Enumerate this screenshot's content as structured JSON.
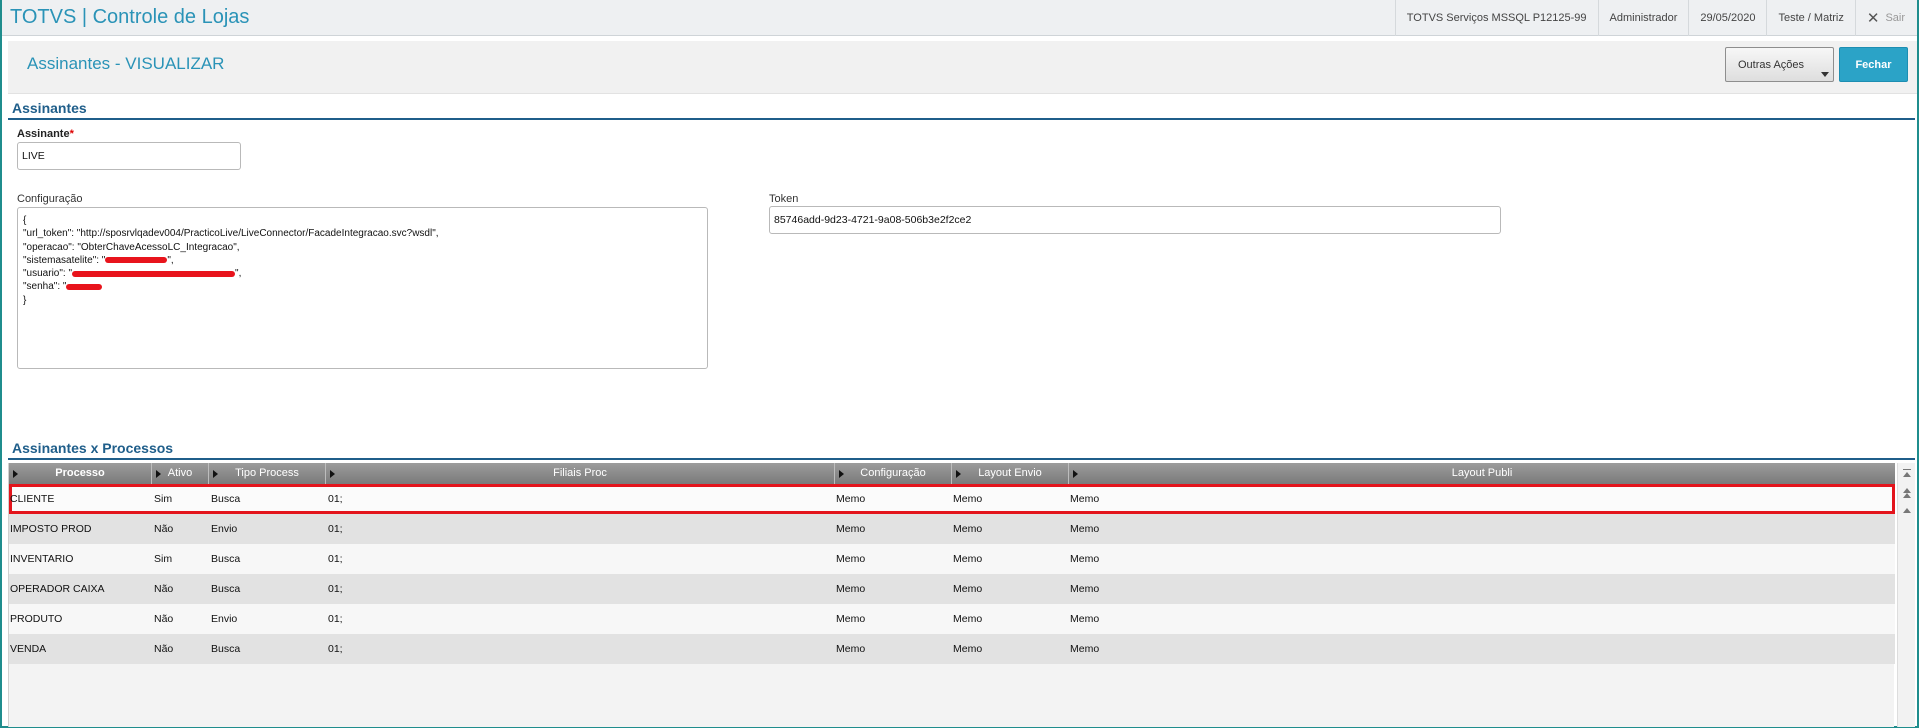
{
  "app": {
    "title": "TOTVS | Controle de Lojas",
    "environment": "TOTVS Serviços MSSQL P12125-99",
    "user": "Administrador",
    "date": "29/05/2020",
    "branch": "Teste / Matriz",
    "exit_label": "Sair"
  },
  "page": {
    "title": "Assinantes - VISUALIZAR",
    "actions": {
      "more_label": "Outras Ações",
      "close_label": "Fechar"
    }
  },
  "form": {
    "section_title": "Assinantes",
    "assinante": {
      "label": "Assinante",
      "required_mark": "*",
      "value": "LIVE"
    },
    "configuracao": {
      "label": "Configuração",
      "lines": [
        "{",
        "\"url_token\": \"http://sposrvlqadev004/PracticoLive/LiveConnector/FacadeIntegracao.svc?wsdl\",",
        "\"operacao\": \"ObterChaveAcessoLC_Integracao\",",
        "\"sistemasatelite\": \"",
        "\"usuario\": \"",
        "\"senha\": \"",
        "}"
      ],
      "line_tail_after_redaction": "\","
    },
    "token": {
      "label": "Token",
      "value": "85746add-9d23-4721-9a08-506b3e2f2ce2"
    }
  },
  "grid": {
    "section_title": "Assinantes x Processos",
    "columns": [
      "Processo",
      "Ativo",
      "Tipo Process",
      "Filiais Proc",
      "Configuração",
      "Layout Envio",
      "Layout Publi"
    ],
    "rows": [
      [
        "CLIENTE",
        "Sim",
        "Busca",
        "01;",
        "Memo",
        "Memo",
        "Memo"
      ],
      [
        "IMPOSTO PROD",
        "Não",
        "Envio",
        "01;",
        "Memo",
        "Memo",
        "Memo"
      ],
      [
        "INVENTARIO",
        "Sim",
        "Busca",
        "01;",
        "Memo",
        "Memo",
        "Memo"
      ],
      [
        "OPERADOR CAIXA",
        "Não",
        "Busca",
        "01;",
        "Memo",
        "Memo",
        "Memo"
      ],
      [
        "PRODUTO",
        "Não",
        "Envio",
        "01;",
        "Memo",
        "Memo",
        "Memo"
      ],
      [
        "VENDA",
        "Não",
        "Busca",
        "01;",
        "Memo",
        "Memo",
        "Memo"
      ]
    ],
    "selected_row": 0
  },
  "colors": {
    "accent": "#2a93b7",
    "section": "#1f5e8a",
    "primary_button": "#2ba3c7",
    "selection_outline": "#e3141c",
    "redaction": "#e8141c"
  }
}
